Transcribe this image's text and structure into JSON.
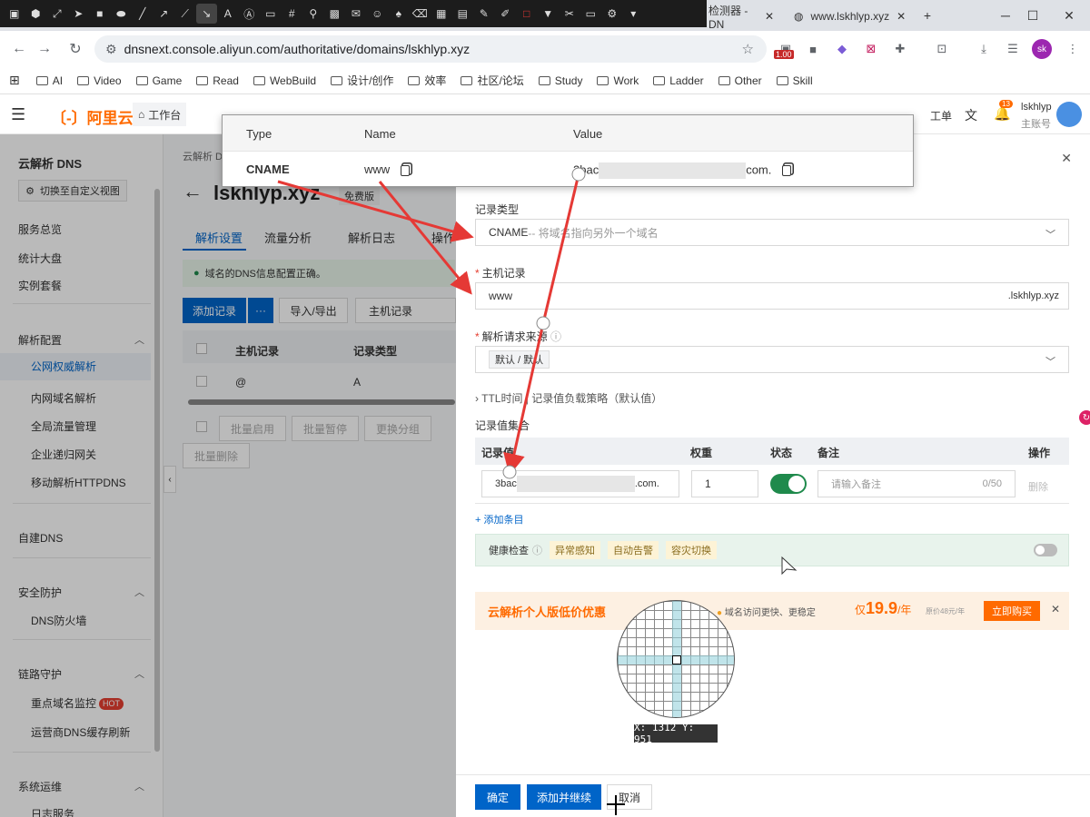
{
  "browser": {
    "tabs": [
      {
        "title": "检测器 - DN"
      },
      {
        "title": "www.lskhlyp.xyz"
      }
    ],
    "url": "dnsnext.console.aliyun.com/authoritative/domains/lskhlyp.xyz",
    "badge": "1.00",
    "profile": "sk",
    "bookmarks": [
      "AI",
      "Video",
      "Game",
      "Read",
      "WebBuild",
      "设计/创作",
      "效率",
      "社区/论坛",
      "Study",
      "Work",
      "Ladder",
      "Other",
      "Skill"
    ]
  },
  "appbar": {
    "logo": "阿里云",
    "workbench": "工作台",
    "ticket": "工单",
    "notify_count": "13",
    "user": "lskhlyp",
    "role": "主账号"
  },
  "sidebar": {
    "title": "云解析 DNS",
    "switch_view": "切换至自定义视图",
    "items": {
      "overview": "服务总览",
      "stats": "统计大盘",
      "instance": "实例套餐",
      "config": "解析配置",
      "public": "公网权威解析",
      "private": "内网域名解析",
      "gtm": "全局流量管理",
      "gateway": "企业递归网关",
      "httpdns": "移动解析HTTPDNS",
      "custom": "自建DNS",
      "security": "安全防护",
      "firewall": "DNS防火墙",
      "link": "链路守护",
      "monitor": "重点域名监控",
      "hot": "HOT",
      "cache": "运营商DNS缓存刷新",
      "ops": "系统运维",
      "log": "日志服务"
    }
  },
  "main": {
    "breadcrumb": "云解析 D",
    "domain": "lskhlyp.xyz",
    "edition": "免费版",
    "tabs": [
      "解析设置",
      "流量分析",
      "解析日志",
      "操作"
    ],
    "notice": "域名的DNS信息配置正确。",
    "add_record": "添加记录",
    "more": "···",
    "import_export": "导入/导出",
    "filter": "主机记录",
    "col_host": "主机记录",
    "col_type": "记录类型",
    "row_host": "@",
    "row_type": "A",
    "batch_enable": "批量启用",
    "batch_pause": "批量暂停",
    "change_group": "更换分组",
    "batch_delete": "批量删除"
  },
  "drawer": {
    "type_label": "记录类型",
    "type_value": "CNAME",
    "type_hint": " -- 将域名指向另外一个域名",
    "host_label": "主机记录",
    "host_value": "www",
    "host_suffix": ".lskhlyp.xyz",
    "source_label": "解析请求来源",
    "source_value": "默认 / 默认",
    "ttl": "TTL时间 | 记录值负载策略（默认值）",
    "set_label": "记录值集合",
    "col_value": "记录值",
    "col_weight": "权重",
    "col_status": "状态",
    "col_note": "备注",
    "col_op": "操作",
    "rec_prefix": "3bac",
    "rec_suffix": ".com.",
    "weight": "1",
    "note_placeholder": "请输入备注",
    "note_count": "0/50",
    "delete": "删除",
    "add_item": "+ 添加条目",
    "health": "健康检查",
    "health_tags": [
      "异常感知",
      "自动告警",
      "容灾切换"
    ],
    "promo_title": "云解析个人版低价优惠",
    "promo_item": "域名访问更快、更稳定",
    "promo_price_prefix": "仅",
    "promo_price": "19.9",
    "promo_unit": "/年",
    "promo_orig": "原价48元/年",
    "promo_buy": "立即购买",
    "confirm": "确定",
    "add_continue": "添加并继续",
    "cancel": "取消"
  },
  "popup": {
    "headers": [
      "Type",
      "Name",
      "Value"
    ],
    "type": "CNAME",
    "name": "www",
    "value_prefix": "3bac",
    "value_suffix": "com."
  },
  "magnifier": {
    "coord": "X: 1312 Y: 951"
  },
  "colors": {
    "accent": "#0064c8",
    "brand": "#ff6a00",
    "arrow": "#e53935",
    "toggle": "#1f8a4c"
  }
}
